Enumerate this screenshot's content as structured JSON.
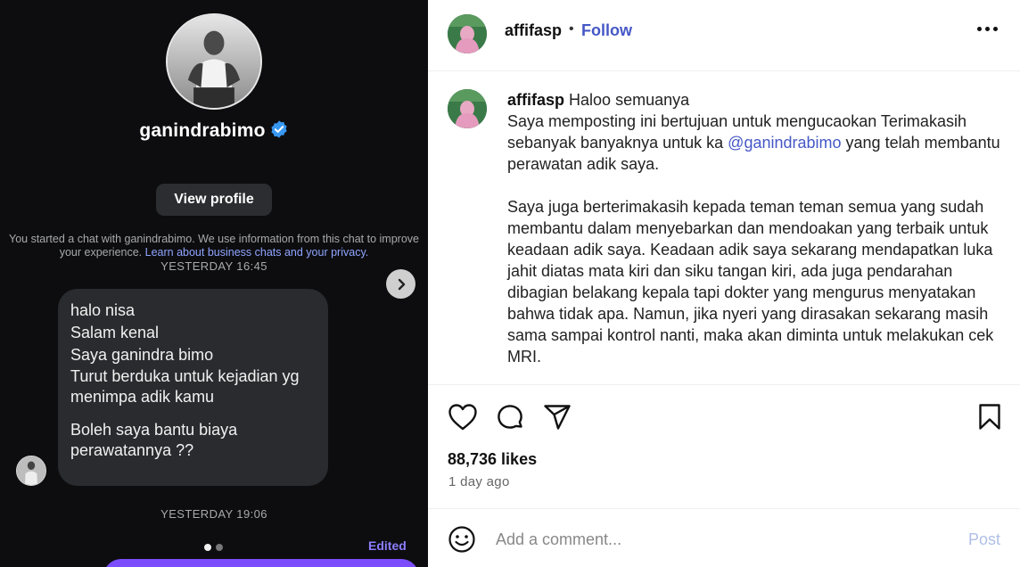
{
  "chat": {
    "profile_name": "ganindrabimo",
    "view_profile": "View profile",
    "info_text": "You started a chat with ganindrabimo. We use information from this chat to improve your experience. ",
    "info_link": "Learn about business chats and your privacy.",
    "timestamp1": "YESTERDAY 16:45",
    "message_lines": [
      "halo nisa",
      "Salam kenal",
      "Saya ganindra bimo",
      "Turut berduka untuk kejadian yg",
      "menimpa adik kamu",
      "Boleh saya bantu biaya",
      "perawatannya ??"
    ],
    "timestamp2": "YESTERDAY 19:06",
    "edited": "Edited",
    "colors": {
      "background": "#0d0d0f",
      "bubble": "#2a2b2f",
      "accent": "#7b4dfc",
      "verified": "#3897f0"
    }
  },
  "post": {
    "username": "affifasp",
    "dot": "•",
    "follow": "Follow",
    "more_icon": "more-horizontal-icon",
    "caption": {
      "username": "affifasp",
      "greeting": "Haloo semuanya",
      "p1_before": "Saya memposting ini bertujuan untuk mengucaokan Terimakasih sebanyak banyaknya untuk ka ",
      "mention": "@ganindrabimo",
      "p1_after": " yang telah membantu perawatan adik saya.",
      "p2": "Saya juga berterimakasih kepada teman teman semua yang sudah membantu dalam menyebarkan dan mendoakan yang terbaik untuk keadaan adik saya. Keadaan adik saya sekarang mendapatkan luka jahit diatas mata kiri dan siku tangan kiri, ada juga pendarahan dibagian belakang kepala tapi dokter yang mengurus menyatakan bahwa tidak apa. Namun, jika nyeri yang dirasakan sekarang masih sama sampai kontrol nanti, maka akan diminta untuk melakukan cek MRI."
    },
    "likes": "88,736 likes",
    "time_ago": "1 day ago",
    "comment_placeholder": "Add a comment...",
    "post_button": "Post",
    "icons": [
      "heart-icon",
      "comment-icon",
      "share-icon",
      "bookmark-icon",
      "emoji-icon"
    ],
    "colors": {
      "link": "#4558c6",
      "post_disabled": "#b0bfe6"
    }
  }
}
